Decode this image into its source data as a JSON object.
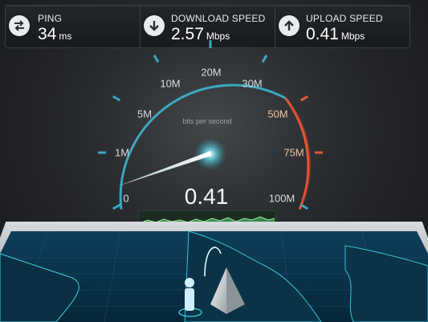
{
  "metrics": {
    "ping": {
      "label": "PING",
      "value": "34",
      "unit": "ms",
      "icon": "ping-arrows-icon"
    },
    "download": {
      "label": "DOWNLOAD SPEED",
      "value": "2.57",
      "unit": "Mbps",
      "icon": "download-arrow-icon"
    },
    "upload": {
      "label": "UPLOAD SPEED",
      "value": "0.41",
      "unit": "Mbps",
      "icon": "upload-arrow-icon"
    }
  },
  "gauge": {
    "scale_labels": [
      "0",
      "1M",
      "5M",
      "10M",
      "20M",
      "30M",
      "50M",
      "75M",
      "100M"
    ],
    "units_caption": "bits per second",
    "reading": "0.41",
    "needle_fraction_of_dial": 0.16,
    "colors": {
      "normal": "#39b3c8",
      "high": "#e85a3c",
      "needle_glow": "#7ff4ff"
    }
  },
  "map": {
    "pin_icon": "server-pyramid-icon",
    "user_icon": "user-figure-icon"
  }
}
